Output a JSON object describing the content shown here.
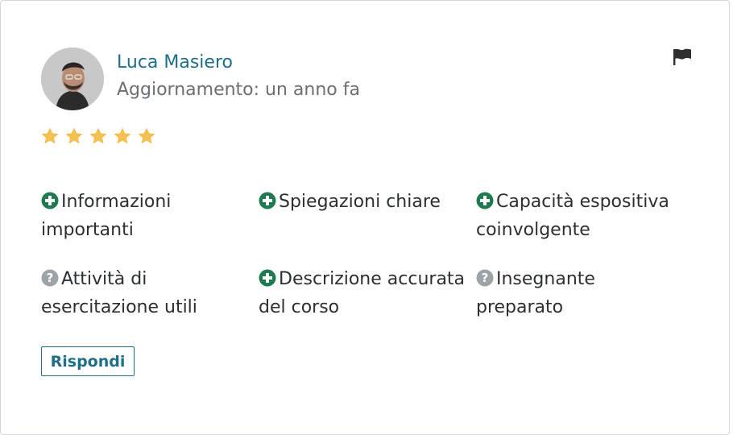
{
  "review": {
    "reviewer_name": "Luca Masiero",
    "updated_text": "Aggiornamento: un anno fa",
    "rating": 5,
    "max_rating": 5,
    "star_color": "#f4c150"
  },
  "tags": [
    {
      "icon": "plus-circle-icon",
      "label": "Informazioni importanti"
    },
    {
      "icon": "plus-circle-icon",
      "label": "Spiegazioni chiare"
    },
    {
      "icon": "plus-circle-icon",
      "label": "Capacità espositiva coinvolgente"
    },
    {
      "icon": "question-circle-icon",
      "label": "Attività di esercitazione utili"
    },
    {
      "icon": "plus-circle-icon",
      "label": "Descrizione accurata del corso"
    },
    {
      "icon": "question-circle-icon",
      "label": "Insegnante preparato"
    }
  ],
  "colors": {
    "positive": "#1e7b4f",
    "neutral": "#9da3a7",
    "accent": "#1e6f8a"
  },
  "actions": {
    "reply_label": "Rispondi"
  },
  "icons": {
    "flag": "flag-icon",
    "avatar": "avatar"
  }
}
